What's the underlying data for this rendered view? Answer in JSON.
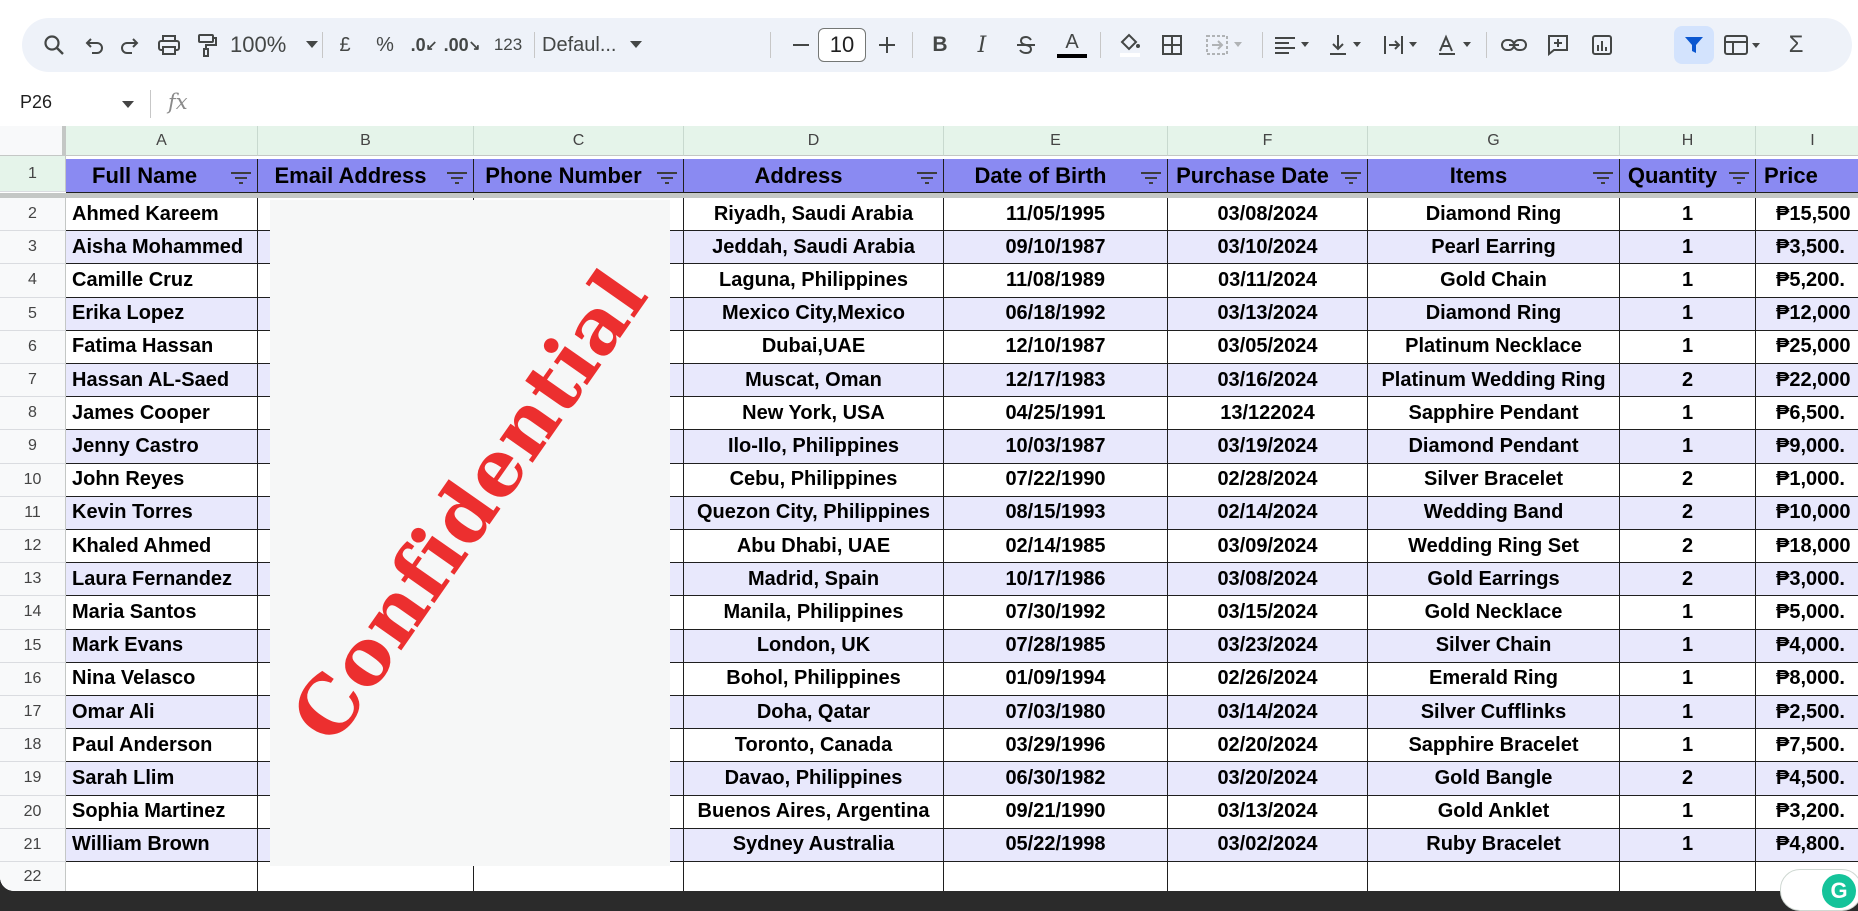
{
  "toolbar": {
    "zoom": "100%",
    "currency_symbol": "£",
    "percent_symbol": "%",
    "decrease_decimal": ".0",
    "increase_decimal": ".00",
    "number_format": "123",
    "font_name": "Defaul...",
    "font_size": "10",
    "bold": "B",
    "italic": "I",
    "text_color": "A",
    "sum": "Σ",
    "icons": [
      "search-icon",
      "undo-icon",
      "redo-icon",
      "print-icon",
      "paint-format-icon",
      "font-size-minus-icon",
      "font-size-plus-icon",
      "strikethrough-icon",
      "fill-color-icon",
      "borders-icon",
      "merge-cells-icon",
      "align-left-icon",
      "valign-bottom-icon",
      "text-wrap-icon",
      "text-rotate-icon",
      "link-icon",
      "comment-icon",
      "chart-icon",
      "filter-icon",
      "table-icon",
      "functions-icon"
    ]
  },
  "formula_bar": {
    "cell_ref": "P26",
    "fx": "fx",
    "value": ""
  },
  "column_letters": [
    "A",
    "B",
    "C",
    "D",
    "E",
    "F",
    "G",
    "H",
    "I"
  ],
  "headers": [
    "Full Name",
    "Email Address",
    "Phone Number",
    "Address",
    "Date of Birth",
    "Purchase Date",
    "Items",
    "Quantity",
    "Price"
  ],
  "rows": [
    {
      "n": "2",
      "name": "Ahmed Kareem",
      "address": "Riyadh, Saudi Arabia",
      "dob": "11/05/1995",
      "purchase": "03/08/2024",
      "item": "Diamond Ring",
      "qty": "1",
      "price": "₱15,500"
    },
    {
      "n": "3",
      "name": "Aisha Mohammed",
      "address": "Jeddah, Saudi Arabia",
      "dob": "09/10/1987",
      "purchase": "03/10/2024",
      "item": "Pearl Earring",
      "qty": "1",
      "price": "₱3,500."
    },
    {
      "n": "4",
      "name": "Camille Cruz",
      "address": "Laguna, Philippines",
      "dob": "11/08/1989",
      "purchase": "03/11/2024",
      "item": "Gold Chain",
      "qty": "1",
      "price": "₱5,200."
    },
    {
      "n": "5",
      "name": "Erika Lopez",
      "address": "Mexico City,Mexico",
      "dob": "06/18/1992",
      "purchase": "03/13/2024",
      "item": "Diamond Ring",
      "qty": "1",
      "price": "₱12,000"
    },
    {
      "n": "6",
      "name": "Fatima Hassan",
      "address": "Dubai,UAE",
      "dob": "12/10/1987",
      "purchase": "03/05/2024",
      "item": "Platinum Necklace",
      "qty": "1",
      "price": "₱25,000"
    },
    {
      "n": "7",
      "name": "Hassan AL-Saed",
      "address": "Muscat, Oman",
      "dob": "12/17/1983",
      "purchase": "03/16/2024",
      "item": "Platinum Wedding Ring",
      "qty": "2",
      "price": "₱22,000"
    },
    {
      "n": "8",
      "name": "James Cooper",
      "address": "New York, USA",
      "dob": "04/25/1991",
      "purchase": "13/122024",
      "item": "Sapphire Pendant",
      "qty": "1",
      "price": "₱6,500."
    },
    {
      "n": "9",
      "name": "Jenny Castro",
      "address": "Ilo-Ilo, Philippines",
      "dob": "10/03/1987",
      "purchase": "03/19/2024",
      "item": "Diamond Pendant",
      "qty": "1",
      "price": "₱9,000."
    },
    {
      "n": "10",
      "name": "John Reyes",
      "address": "Cebu, Philippines",
      "dob": "07/22/1990",
      "purchase": "02/28/2024",
      "item": "Silver Bracelet",
      "qty": "2",
      "price": "₱1,000."
    },
    {
      "n": "11",
      "name": "Kevin Torres",
      "address": "Quezon City, Philippines",
      "dob": "08/15/1993",
      "purchase": "02/14/2024",
      "item": "Wedding Band",
      "qty": "2",
      "price": "₱10,000"
    },
    {
      "n": "12",
      "name": "Khaled Ahmed",
      "address": "Abu Dhabi, UAE",
      "dob": "02/14/1985",
      "purchase": "03/09/2024",
      "item": "Wedding Ring Set",
      "qty": "2",
      "price": "₱18,000"
    },
    {
      "n": "13",
      "name": "Laura Fernandez",
      "address": "Madrid, Spain",
      "dob": "10/17/1986",
      "purchase": "03/08/2024",
      "item": "Gold Earrings",
      "qty": "2",
      "price": "₱3,000."
    },
    {
      "n": "14",
      "name": "Maria Santos",
      "address": "Manila, Philippines",
      "dob": "07/30/1992",
      "purchase": "03/15/2024",
      "item": "Gold Necklace",
      "qty": "1",
      "price": "₱5,000."
    },
    {
      "n": "15",
      "name": "Mark Evans",
      "address": "London, UK",
      "dob": "07/28/1985",
      "purchase": "03/23/2024",
      "item": "Silver Chain",
      "qty": "1",
      "price": "₱4,000."
    },
    {
      "n": "16",
      "name": "Nina Velasco",
      "address": "Bohol, Philippines",
      "dob": "01/09/1994",
      "purchase": "02/26/2024",
      "item": "Emerald Ring",
      "qty": "1",
      "price": "₱8,000."
    },
    {
      "n": "17",
      "name": "Omar Ali",
      "address": "Doha, Qatar",
      "dob": "07/03/1980",
      "purchase": "03/14/2024",
      "item": "Silver Cufflinks",
      "qty": "1",
      "price": "₱2,500."
    },
    {
      "n": "18",
      "name": "Paul Anderson",
      "address": "Toronto, Canada",
      "dob": "03/29/1996",
      "purchase": "02/20/2024",
      "item": "Sapphire Bracelet",
      "qty": "1",
      "price": "₱7,500."
    },
    {
      "n": "19",
      "name": "Sarah Llim",
      "address": "Davao, Philippines",
      "dob": "06/30/1982",
      "purchase": "03/20/2024",
      "item": "Gold Bangle",
      "qty": "2",
      "price": "₱4,500."
    },
    {
      "n": "20",
      "name": "Sophia Martinez",
      "address": "Buenos Aires, Argentina",
      "dob": "09/21/1990",
      "purchase": "03/13/2024",
      "item": "Gold Anklet",
      "qty": "1",
      "price": "₱3,200."
    },
    {
      "n": "21",
      "name": "William Brown",
      "address": "Sydney Australia",
      "dob": "05/22/1998",
      "purchase": "03/02/2024",
      "item": "Ruby Bracelet",
      "qty": "1",
      "price": "₱4,800."
    }
  ],
  "header_row_number": "1",
  "empty_row_number": "22",
  "watermark": "Confidential",
  "colors": {
    "header_fill": "#8a8af2",
    "band_fill": "#e8e8fc",
    "stamp": "#ec2f2f",
    "column_header": "#e5f4ea"
  }
}
